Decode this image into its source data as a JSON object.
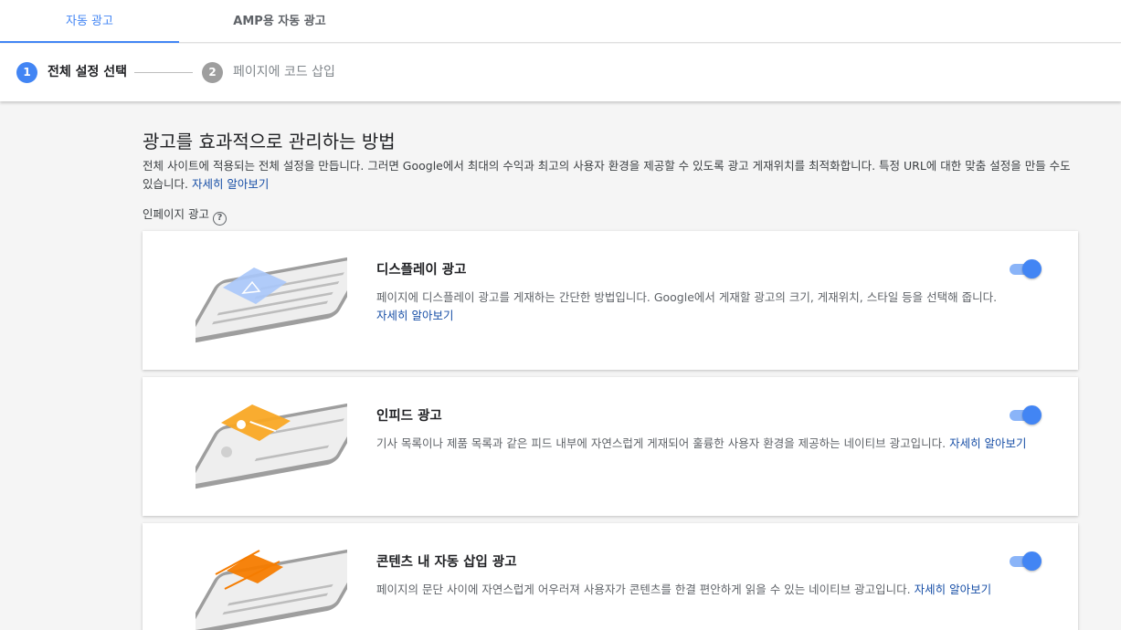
{
  "tabs": [
    {
      "label": "자동 광고"
    },
    {
      "label": "AMP용 자동 광고"
    }
  ],
  "stepper": {
    "step1": {
      "number": "1",
      "label": "전체 설정 선택"
    },
    "step2": {
      "number": "2",
      "label": "페이지에 코드 삽입"
    }
  },
  "main": {
    "heading": "광고를 효과적으로 관리하는 방법",
    "description": "전체 사이트에 적용되는 전체 설정을 만듭니다. 그러면 Google에서 최대의 수익과 최고의 사용자 환경을 제공할 수 있도록 광고 게재위치를 최적화합니다. 특정 URL에 대한 맞춤 설정을 만들 수도 있습니다. ",
    "learn_more": "자세히 알아보기",
    "section_label": "인페이지 광고",
    "help_icon": "?"
  },
  "cards": [
    {
      "title": "디스플레이 광고",
      "text": "페이지에 디스플레이 광고를 게재하는 간단한 방법입니다. Google에서 게재할 광고의 크기, 게재위치, 스타일 등을 선택해 줍니다. ",
      "link": "자세히 알아보기",
      "enabled": true,
      "accent": "#a8c7fa"
    },
    {
      "title": "인피드 광고",
      "text": "기사 목록이나 제품 목록과 같은 피드 내부에 자연스럽게 게재되어 훌륭한 사용자 환경을 제공하는 네이티브 광고입니다. ",
      "link": "자세히 알아보기",
      "enabled": true,
      "accent": "#f9a825"
    },
    {
      "title": "콘텐츠 내 자동 삽입 광고",
      "text": "페이지의 문단 사이에 자연스럽게 어우러져 사용자가 콘텐츠를 한결 편안하게 읽을 수 있는 네이티브 광고입니다. ",
      "link": "자세히 알아보기",
      "enabled": true,
      "accent": "#f57c00"
    }
  ],
  "colors": {
    "primary": "#4285f4",
    "toggle_track": "#8ab4f8",
    "link": "#174ea6"
  }
}
